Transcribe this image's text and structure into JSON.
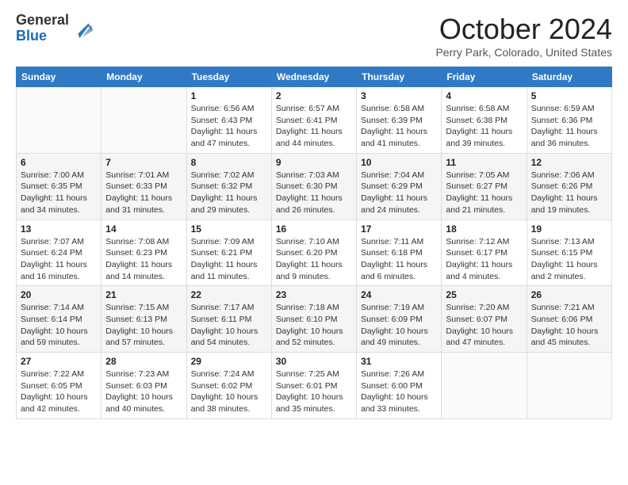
{
  "header": {
    "logo_general": "General",
    "logo_blue": "Blue",
    "month_title": "October 2024",
    "location": "Perry Park, Colorado, United States"
  },
  "days_of_week": [
    "Sunday",
    "Monday",
    "Tuesday",
    "Wednesday",
    "Thursday",
    "Friday",
    "Saturday"
  ],
  "weeks": [
    [
      {
        "day": "",
        "sunrise": "",
        "sunset": "",
        "daylight": ""
      },
      {
        "day": "",
        "sunrise": "",
        "sunset": "",
        "daylight": ""
      },
      {
        "day": "1",
        "sunrise": "Sunrise: 6:56 AM",
        "sunset": "Sunset: 6:43 PM",
        "daylight": "Daylight: 11 hours and 47 minutes."
      },
      {
        "day": "2",
        "sunrise": "Sunrise: 6:57 AM",
        "sunset": "Sunset: 6:41 PM",
        "daylight": "Daylight: 11 hours and 44 minutes."
      },
      {
        "day": "3",
        "sunrise": "Sunrise: 6:58 AM",
        "sunset": "Sunset: 6:39 PM",
        "daylight": "Daylight: 11 hours and 41 minutes."
      },
      {
        "day": "4",
        "sunrise": "Sunrise: 6:58 AM",
        "sunset": "Sunset: 6:38 PM",
        "daylight": "Daylight: 11 hours and 39 minutes."
      },
      {
        "day": "5",
        "sunrise": "Sunrise: 6:59 AM",
        "sunset": "Sunset: 6:36 PM",
        "daylight": "Daylight: 11 hours and 36 minutes."
      }
    ],
    [
      {
        "day": "6",
        "sunrise": "Sunrise: 7:00 AM",
        "sunset": "Sunset: 6:35 PM",
        "daylight": "Daylight: 11 hours and 34 minutes."
      },
      {
        "day": "7",
        "sunrise": "Sunrise: 7:01 AM",
        "sunset": "Sunset: 6:33 PM",
        "daylight": "Daylight: 11 hours and 31 minutes."
      },
      {
        "day": "8",
        "sunrise": "Sunrise: 7:02 AM",
        "sunset": "Sunset: 6:32 PM",
        "daylight": "Daylight: 11 hours and 29 minutes."
      },
      {
        "day": "9",
        "sunrise": "Sunrise: 7:03 AM",
        "sunset": "Sunset: 6:30 PM",
        "daylight": "Daylight: 11 hours and 26 minutes."
      },
      {
        "day": "10",
        "sunrise": "Sunrise: 7:04 AM",
        "sunset": "Sunset: 6:29 PM",
        "daylight": "Daylight: 11 hours and 24 minutes."
      },
      {
        "day": "11",
        "sunrise": "Sunrise: 7:05 AM",
        "sunset": "Sunset: 6:27 PM",
        "daylight": "Daylight: 11 hours and 21 minutes."
      },
      {
        "day": "12",
        "sunrise": "Sunrise: 7:06 AM",
        "sunset": "Sunset: 6:26 PM",
        "daylight": "Daylight: 11 hours and 19 minutes."
      }
    ],
    [
      {
        "day": "13",
        "sunrise": "Sunrise: 7:07 AM",
        "sunset": "Sunset: 6:24 PM",
        "daylight": "Daylight: 11 hours and 16 minutes."
      },
      {
        "day": "14",
        "sunrise": "Sunrise: 7:08 AM",
        "sunset": "Sunset: 6:23 PM",
        "daylight": "Daylight: 11 hours and 14 minutes."
      },
      {
        "day": "15",
        "sunrise": "Sunrise: 7:09 AM",
        "sunset": "Sunset: 6:21 PM",
        "daylight": "Daylight: 11 hours and 11 minutes."
      },
      {
        "day": "16",
        "sunrise": "Sunrise: 7:10 AM",
        "sunset": "Sunset: 6:20 PM",
        "daylight": "Daylight: 11 hours and 9 minutes."
      },
      {
        "day": "17",
        "sunrise": "Sunrise: 7:11 AM",
        "sunset": "Sunset: 6:18 PM",
        "daylight": "Daylight: 11 hours and 6 minutes."
      },
      {
        "day": "18",
        "sunrise": "Sunrise: 7:12 AM",
        "sunset": "Sunset: 6:17 PM",
        "daylight": "Daylight: 11 hours and 4 minutes."
      },
      {
        "day": "19",
        "sunrise": "Sunrise: 7:13 AM",
        "sunset": "Sunset: 6:15 PM",
        "daylight": "Daylight: 11 hours and 2 minutes."
      }
    ],
    [
      {
        "day": "20",
        "sunrise": "Sunrise: 7:14 AM",
        "sunset": "Sunset: 6:14 PM",
        "daylight": "Daylight: 10 hours and 59 minutes."
      },
      {
        "day": "21",
        "sunrise": "Sunrise: 7:15 AM",
        "sunset": "Sunset: 6:13 PM",
        "daylight": "Daylight: 10 hours and 57 minutes."
      },
      {
        "day": "22",
        "sunrise": "Sunrise: 7:17 AM",
        "sunset": "Sunset: 6:11 PM",
        "daylight": "Daylight: 10 hours and 54 minutes."
      },
      {
        "day": "23",
        "sunrise": "Sunrise: 7:18 AM",
        "sunset": "Sunset: 6:10 PM",
        "daylight": "Daylight: 10 hours and 52 minutes."
      },
      {
        "day": "24",
        "sunrise": "Sunrise: 7:19 AM",
        "sunset": "Sunset: 6:09 PM",
        "daylight": "Daylight: 10 hours and 49 minutes."
      },
      {
        "day": "25",
        "sunrise": "Sunrise: 7:20 AM",
        "sunset": "Sunset: 6:07 PM",
        "daylight": "Daylight: 10 hours and 47 minutes."
      },
      {
        "day": "26",
        "sunrise": "Sunrise: 7:21 AM",
        "sunset": "Sunset: 6:06 PM",
        "daylight": "Daylight: 10 hours and 45 minutes."
      }
    ],
    [
      {
        "day": "27",
        "sunrise": "Sunrise: 7:22 AM",
        "sunset": "Sunset: 6:05 PM",
        "daylight": "Daylight: 10 hours and 42 minutes."
      },
      {
        "day": "28",
        "sunrise": "Sunrise: 7:23 AM",
        "sunset": "Sunset: 6:03 PM",
        "daylight": "Daylight: 10 hours and 40 minutes."
      },
      {
        "day": "29",
        "sunrise": "Sunrise: 7:24 AM",
        "sunset": "Sunset: 6:02 PM",
        "daylight": "Daylight: 10 hours and 38 minutes."
      },
      {
        "day": "30",
        "sunrise": "Sunrise: 7:25 AM",
        "sunset": "Sunset: 6:01 PM",
        "daylight": "Daylight: 10 hours and 35 minutes."
      },
      {
        "day": "31",
        "sunrise": "Sunrise: 7:26 AM",
        "sunset": "Sunset: 6:00 PM",
        "daylight": "Daylight: 10 hours and 33 minutes."
      },
      {
        "day": "",
        "sunrise": "",
        "sunset": "",
        "daylight": ""
      },
      {
        "day": "",
        "sunrise": "",
        "sunset": "",
        "daylight": ""
      }
    ]
  ]
}
